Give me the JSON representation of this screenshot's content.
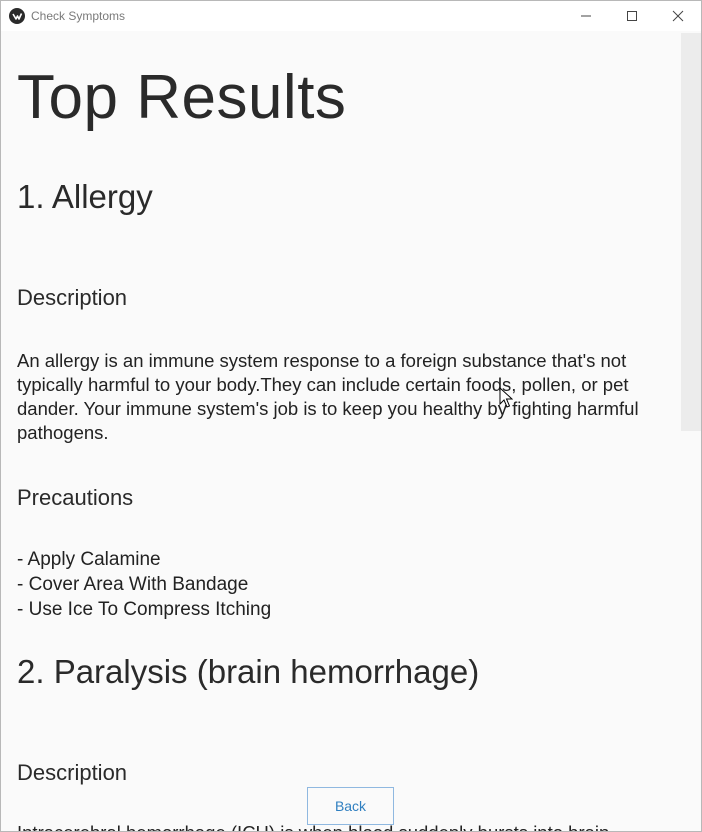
{
  "window": {
    "title": "Check Symptoms",
    "controls": [
      "minimize-icon",
      "maximize-icon",
      "close-icon"
    ]
  },
  "page": {
    "heading": "Top Results",
    "results": [
      {
        "title": "1. Allergy",
        "description_label": "Description",
        "description": "An allergy is an immune system response to a foreign substance that's not typically harmful to your body.They can include certain foods, pollen, or pet dander. Your immune system's job is to keep you healthy by fighting harmful pathogens.",
        "precautions_label": "Precautions",
        "precautions": [
          "- Apply Calamine",
          "- Cover Area With Bandage",
          "- Use Ice To Compress Itching"
        ]
      },
      {
        "title": "2. Paralysis (brain hemorrhage)",
        "description_label": "Description",
        "description_partial": "Intracerebral hemorrhage (ICH) is when blood suddenly bursts into brain"
      }
    ]
  },
  "back_button": {
    "label": "Back"
  },
  "colors": {
    "background": "#fafafa",
    "text": "#222222",
    "back_button_text": "#2f7fc0",
    "back_button_border": "#8fb8e0",
    "scrollbar": "#ececec"
  }
}
